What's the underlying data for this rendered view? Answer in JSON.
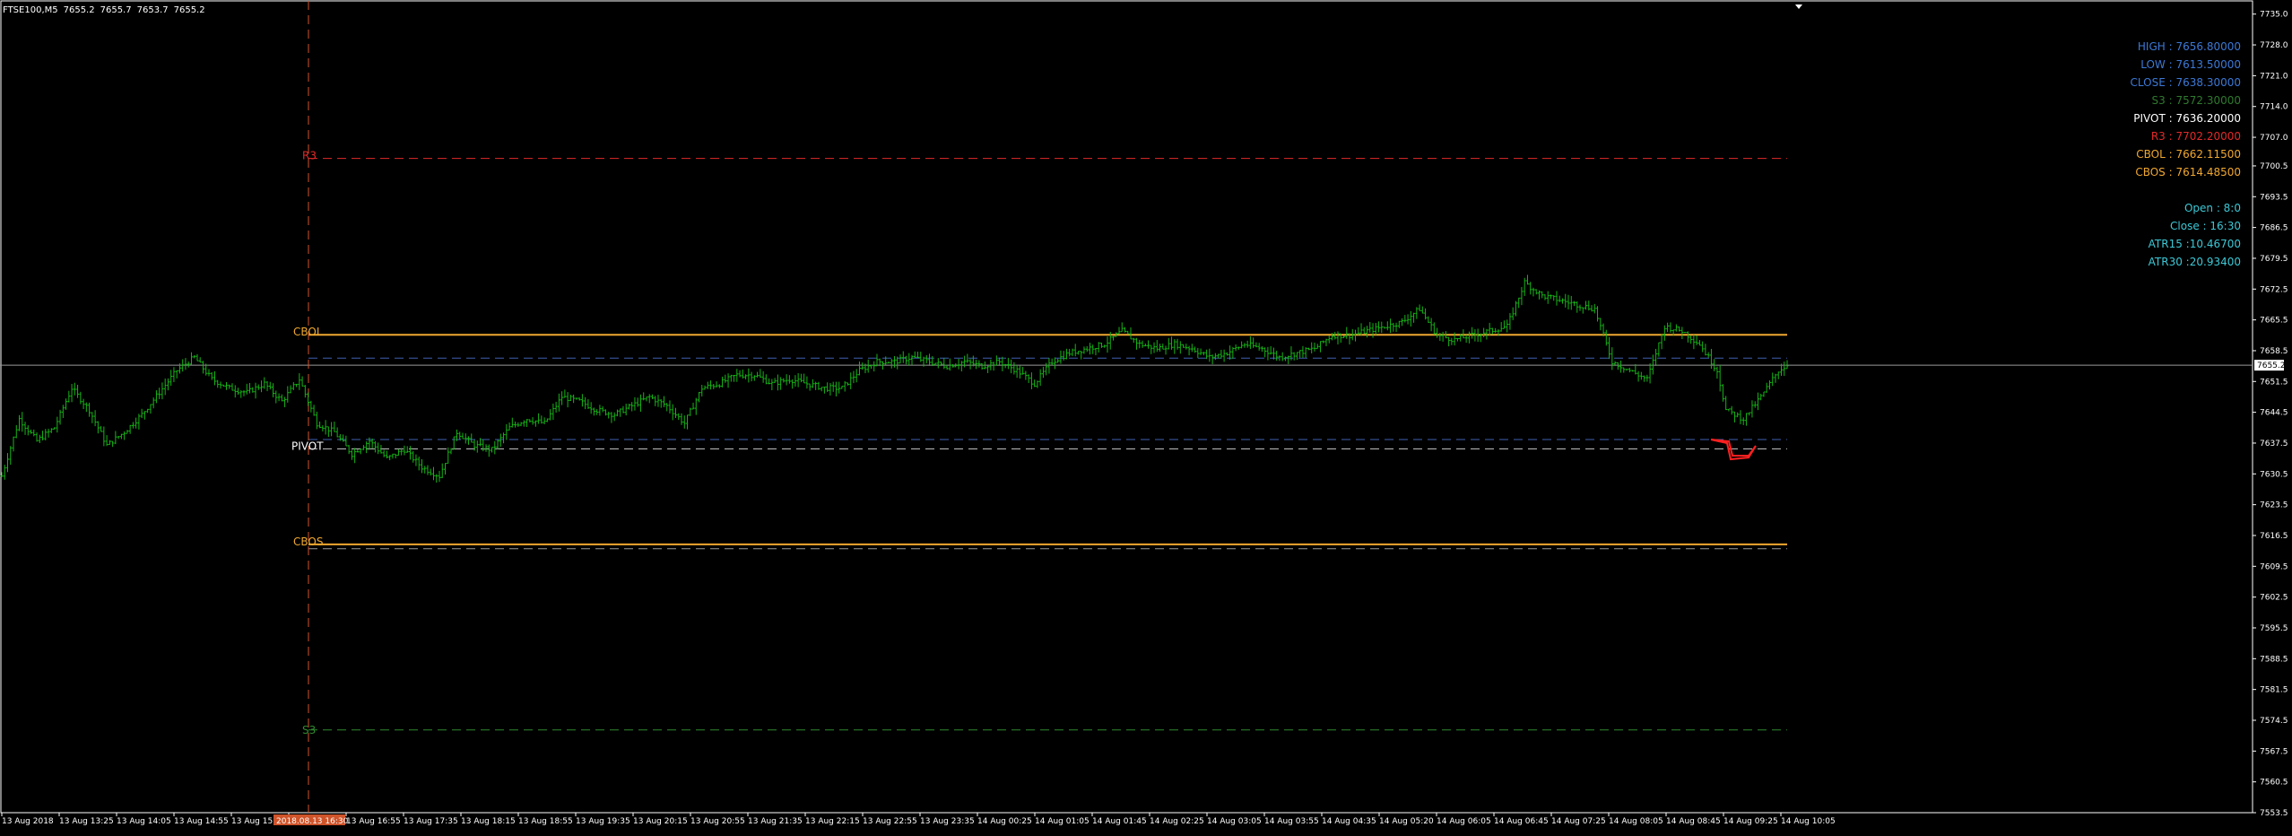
{
  "symbol": {
    "name": "FTSE100,M5",
    "open": "7655.2",
    "high": "7655.7",
    "low": "7653.7",
    "close": "7655.2"
  },
  "colors": {
    "background": "#000000",
    "frame": "#ffffff",
    "candle": "#17b317",
    "r3": "#e22a2a",
    "cbol": "#f0a830",
    "cbos": "#f0a830",
    "pivot": "#ffffff",
    "s3": "#2f8a2f",
    "blue_dash": "#3f5fb0",
    "price_line": "#9a9a9a",
    "period_sep": "#d0542a",
    "info_blue": "#3c79d6",
    "info_cyan": "#3cc8d6",
    "marker": "#ff2020"
  },
  "info_panel": [
    {
      "label": "HIGH : 7656.80000",
      "color": "#3c79d6"
    },
    {
      "label": "LOW : 7613.50000",
      "color": "#3c79d6"
    },
    {
      "label": "CLOSE : 7638.30000",
      "color": "#3c79d6"
    },
    {
      "label": "S3 : 7572.30000",
      "color": "#2f7a2f"
    },
    {
      "label": "PIVOT : 7636.20000",
      "color": "#ffffff"
    },
    {
      "label": "R3 : 7702.20000",
      "color": "#e22a2a"
    },
    {
      "label": "CBOL : 7662.11500",
      "color": "#f0a830"
    },
    {
      "label": "CBOS : 7614.48500",
      "color": "#f0a830"
    },
    {
      "label": "",
      "color": "#000000"
    },
    {
      "label": "Open : 8:0",
      "color": "#3cc8d6"
    },
    {
      "label": "Close : 16:30",
      "color": "#3cc8d6"
    },
    {
      "label": "ATR15 :10.46700",
      "color": "#3cc8d6"
    },
    {
      "label": "ATR30 :20.93400",
      "color": "#3cc8d6"
    }
  ],
  "level_labels": {
    "r3": "R3",
    "cbol": "CBOL",
    "pivot": "PIVOT",
    "cbos": "CBOS",
    "s3": "S3"
  },
  "levels": {
    "r3": 7702.2,
    "cbol": 7662.115,
    "high": 7656.8,
    "close": 7638.3,
    "pivot": 7636.2,
    "cbos": 7614.485,
    "low": 7613.5,
    "s3": 7572.3
  },
  "current_price": "7655.2",
  "period_label": "2018.08.13 16:30",
  "price_axis": [
    "7735.0",
    "7728.0",
    "7721.0",
    "7714.0",
    "7707.0",
    "7700.5",
    "7693.5",
    "7686.5",
    "7679.5",
    "7672.5",
    "7665.5",
    "7658.5",
    "7651.5",
    "7644.5",
    "7637.5",
    "7630.5",
    "7623.5",
    "7616.5",
    "7609.5",
    "7602.5",
    "7595.5",
    "7588.5",
    "7581.5",
    "7574.5",
    "7567.5",
    "7560.5",
    "7553.5"
  ],
  "time_axis": [
    "13 Aug 2018",
    "13 Aug 13:25",
    "13 Aug 14:05",
    "13 Aug 14:55",
    "13 Aug 15:35",
    "",
    "13 Aug 16:55",
    "13 Aug 17:35",
    "13 Aug 18:15",
    "13 Aug 18:55",
    "13 Aug 19:35",
    "13 Aug 20:15",
    "13 Aug 20:55",
    "13 Aug 21:35",
    "13 Aug 22:15",
    "13 Aug 22:55",
    "13 Aug 23:35",
    "14 Aug 00:25",
    "14 Aug 01:05",
    "14 Aug 01:45",
    "14 Aug 02:25",
    "14 Aug 03:05",
    "14 Aug 03:55",
    "14 Aug 04:35",
    "14 Aug 05:20",
    "14 Aug 06:05",
    "14 Aug 06:45",
    "14 Aug 07:25",
    "14 Aug 08:05",
    "14 Aug 08:45",
    "14 Aug 09:25",
    "14 Aug 10:05"
  ],
  "chart_data": {
    "type": "candlestick",
    "ylim": [
      7553.5,
      7738.0
    ],
    "series_path": [
      [
        0,
        7630
      ],
      [
        12,
        7643
      ],
      [
        24,
        7638
      ],
      [
        36,
        7641
      ],
      [
        48,
        7650
      ],
      [
        60,
        7645
      ],
      [
        72,
        7637
      ],
      [
        84,
        7640
      ],
      [
        96,
        7644
      ],
      [
        108,
        7649
      ],
      [
        120,
        7654
      ],
      [
        132,
        7657
      ],
      [
        144,
        7652
      ],
      [
        156,
        7650
      ],
      [
        168,
        7649
      ],
      [
        180,
        7651
      ],
      [
        192,
        7647
      ],
      [
        204,
        7652
      ],
      [
        216,
        7642
      ],
      [
        228,
        7640
      ],
      [
        240,
        7635
      ],
      [
        252,
        7638
      ],
      [
        264,
        7634
      ],
      [
        276,
        7636
      ],
      [
        288,
        7632
      ],
      [
        300,
        7630
      ],
      [
        312,
        7640
      ],
      [
        324,
        7637
      ],
      [
        336,
        7636
      ],
      [
        348,
        7641
      ],
      [
        360,
        7643
      ],
      [
        372,
        7642
      ],
      [
        384,
        7648
      ],
      [
        396,
        7647
      ],
      [
        408,
        7645
      ],
      [
        420,
        7644
      ],
      [
        432,
        7646
      ],
      [
        444,
        7648
      ],
      [
        456,
        7646
      ],
      [
        468,
        7642
      ],
      [
        480,
        7650
      ],
      [
        492,
        7651
      ],
      [
        504,
        7653
      ],
      [
        516,
        7653
      ],
      [
        528,
        7651
      ],
      [
        540,
        7652
      ],
      [
        552,
        7651
      ],
      [
        564,
        7650
      ],
      [
        576,
        7650
      ],
      [
        588,
        7654
      ],
      [
        600,
        7656
      ],
      [
        612,
        7656
      ],
      [
        624,
        7657
      ],
      [
        636,
        7656
      ],
      [
        648,
        7655
      ],
      [
        660,
        7656
      ],
      [
        672,
        7655
      ],
      [
        684,
        7656
      ],
      [
        696,
        7654
      ],
      [
        708,
        7651
      ],
      [
        720,
        7656
      ],
      [
        732,
        7658
      ],
      [
        744,
        7659
      ],
      [
        756,
        7660
      ],
      [
        768,
        7663
      ],
      [
        780,
        7660
      ],
      [
        792,
        7659
      ],
      [
        804,
        7660
      ],
      [
        816,
        7659
      ],
      [
        828,
        7657
      ],
      [
        840,
        7658
      ],
      [
        852,
        7660
      ],
      [
        864,
        7659
      ],
      [
        876,
        7657
      ],
      [
        888,
        7658
      ],
      [
        900,
        7659
      ],
      [
        912,
        7662
      ],
      [
        924,
        7662
      ],
      [
        936,
        7663
      ],
      [
        948,
        7664
      ],
      [
        960,
        7665
      ],
      [
        972,
        7668
      ],
      [
        984,
        7662
      ],
      [
        996,
        7661
      ],
      [
        1008,
        7662
      ],
      [
        1020,
        7663
      ],
      [
        1032,
        7664
      ],
      [
        1044,
        7674
      ],
      [
        1056,
        7671
      ],
      [
        1068,
        7670
      ],
      [
        1080,
        7669
      ],
      [
        1092,
        7668
      ],
      [
        1104,
        7656
      ],
      [
        1116,
        7654
      ],
      [
        1128,
        7652
      ],
      [
        1140,
        7664
      ],
      [
        1152,
        7663
      ],
      [
        1164,
        7660
      ],
      [
        1176,
        7654
      ],
      [
        1182,
        7645
      ],
      [
        1194,
        7643
      ],
      [
        1206,
        7648
      ],
      [
        1218,
        7654
      ],
      [
        1224,
        7655.2
      ]
    ]
  }
}
